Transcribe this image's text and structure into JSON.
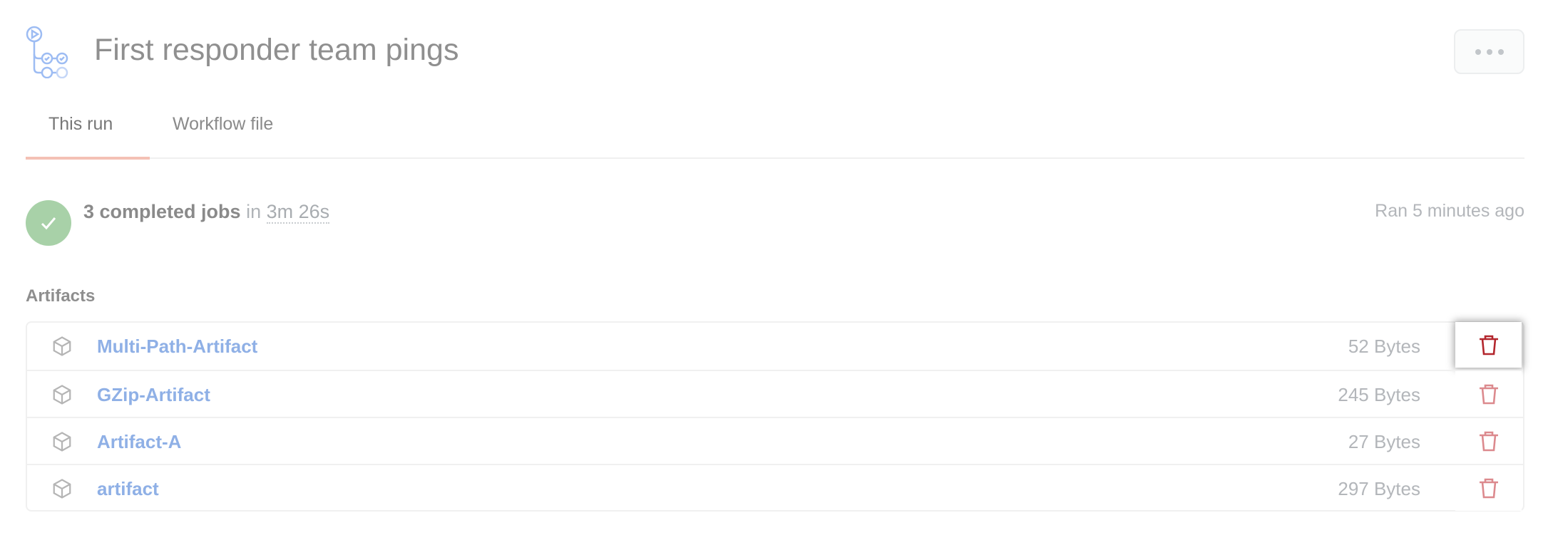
{
  "header": {
    "title": "First responder team pings",
    "icon": "workflow-icon",
    "more_icon": "kebab-horizontal-icon"
  },
  "tabs": [
    {
      "label": "This run",
      "active": true
    },
    {
      "label": "Workflow file",
      "active": false
    }
  ],
  "summary": {
    "status": "success",
    "count_label": "3 completed jobs",
    "in_label": "in",
    "duration": "3m 26s",
    "ran": "Ran 5 minutes ago"
  },
  "artifacts": {
    "heading": "Artifacts",
    "items": [
      {
        "name": "Multi-Path-Artifact",
        "size": "52 Bytes"
      },
      {
        "name": "GZip-Artifact",
        "size": "245 Bytes"
      },
      {
        "name": "Artifact-A",
        "size": "27 Bytes"
      },
      {
        "name": "artifact",
        "size": "297 Bytes"
      }
    ]
  },
  "colors": {
    "accent": "#f4c1b5",
    "success": "#a8d1a8",
    "link": "#8fb0e6",
    "danger": "#b3262d",
    "danger_faded": "#dc8a8e"
  }
}
